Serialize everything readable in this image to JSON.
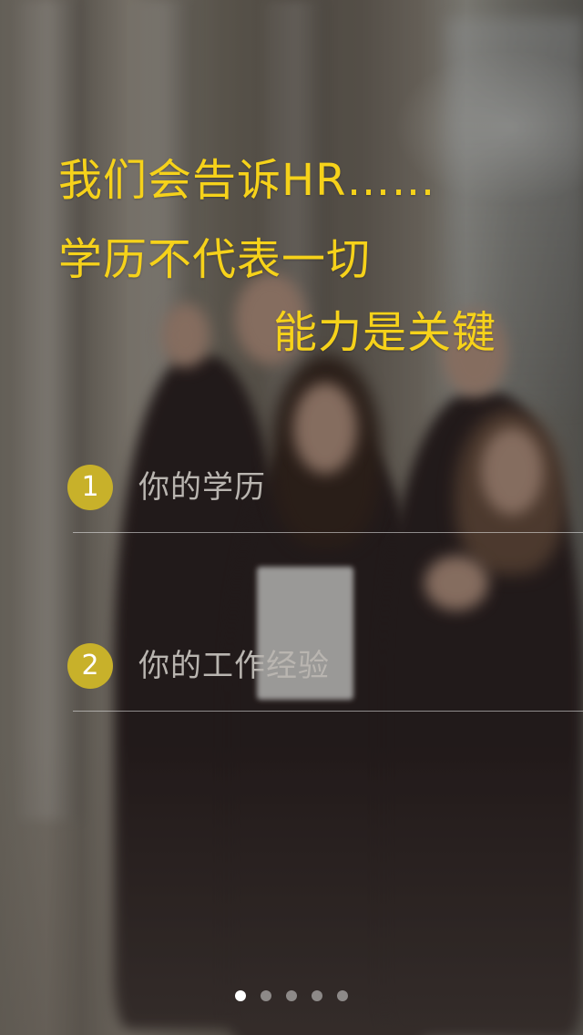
{
  "headline": {
    "line1": "我们会告诉HR……",
    "line2": "学历不代表一切",
    "line3": "能力是关键",
    "color": "#f6d21a"
  },
  "items": [
    {
      "number": "1",
      "label": "你的学历"
    },
    {
      "number": "2",
      "label": "你的工作经验"
    }
  ],
  "pager": {
    "count": 5,
    "active_index": 0
  },
  "colors": {
    "badge": "#c8b12a",
    "label": "#b9b5b0",
    "divider": "#e6e6e6"
  }
}
